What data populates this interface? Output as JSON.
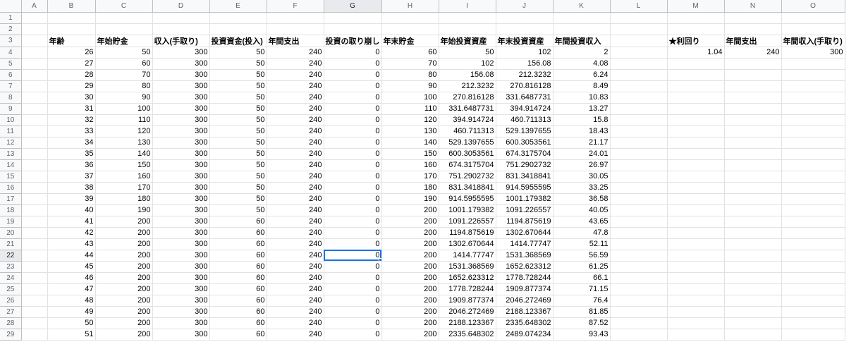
{
  "sheet": {
    "columns": [
      "",
      "A",
      "B",
      "C",
      "D",
      "E",
      "F",
      "G",
      "H",
      "I",
      "J",
      "K",
      "L",
      "M",
      "N",
      "O"
    ],
    "active_cell": {
      "row": 22,
      "col": "G"
    },
    "rows": [
      {
        "n": "1",
        "c": {}
      },
      {
        "n": "2",
        "c": {}
      },
      {
        "n": "3",
        "c": {
          "B": "年齢",
          "C": "年始貯金",
          "D": "収入(手取り)",
          "E": "投資資金(投入)",
          "F": "年間支出",
          "G": "投資の取り崩し",
          "H": "年末貯金",
          "I": "年始投資資産",
          "J": "年末投資資産",
          "K": "年間投資収入",
          "M": "★利回り",
          "N": "年間支出",
          "O": "年間収入(手取り)"
        }
      },
      {
        "n": "4",
        "c": {
          "B": "26",
          "C": "50",
          "D": "300",
          "E": "50",
          "F": "240",
          "G": "0",
          "H": "60",
          "I": "50",
          "J": "102",
          "K": "2",
          "M": "1.04",
          "N": "240",
          "O": "300"
        }
      },
      {
        "n": "5",
        "c": {
          "B": "27",
          "C": "60",
          "D": "300",
          "E": "50",
          "F": "240",
          "G": "0",
          "H": "70",
          "I": "102",
          "J": "156.08",
          "K": "4.08"
        }
      },
      {
        "n": "6",
        "c": {
          "B": "28",
          "C": "70",
          "D": "300",
          "E": "50",
          "F": "240",
          "G": "0",
          "H": "80",
          "I": "156.08",
          "J": "212.3232",
          "K": "6.24"
        }
      },
      {
        "n": "7",
        "c": {
          "B": "29",
          "C": "80",
          "D": "300",
          "E": "50",
          "F": "240",
          "G": "0",
          "H": "90",
          "I": "212.3232",
          "J": "270.816128",
          "K": "8.49"
        }
      },
      {
        "n": "8",
        "c": {
          "B": "30",
          "C": "90",
          "D": "300",
          "E": "50",
          "F": "240",
          "G": "0",
          "H": "100",
          "I": "270.816128",
          "J": "331.6487731",
          "K": "10.83"
        }
      },
      {
        "n": "9",
        "c": {
          "B": "31",
          "C": "100",
          "D": "300",
          "E": "50",
          "F": "240",
          "G": "0",
          "H": "110",
          "I": "331.6487731",
          "J": "394.914724",
          "K": "13.27"
        }
      },
      {
        "n": "10",
        "c": {
          "B": "32",
          "C": "110",
          "D": "300",
          "E": "50",
          "F": "240",
          "G": "0",
          "H": "120",
          "I": "394.914724",
          "J": "460.711313",
          "K": "15.8"
        }
      },
      {
        "n": "11",
        "c": {
          "B": "33",
          "C": "120",
          "D": "300",
          "E": "50",
          "F": "240",
          "G": "0",
          "H": "130",
          "I": "460.711313",
          "J": "529.1397655",
          "K": "18.43"
        }
      },
      {
        "n": "12",
        "c": {
          "B": "34",
          "C": "130",
          "D": "300",
          "E": "50",
          "F": "240",
          "G": "0",
          "H": "140",
          "I": "529.1397655",
          "J": "600.3053561",
          "K": "21.17"
        }
      },
      {
        "n": "13",
        "c": {
          "B": "35",
          "C": "140",
          "D": "300",
          "E": "50",
          "F": "240",
          "G": "0",
          "H": "150",
          "I": "600.3053561",
          "J": "674.3175704",
          "K": "24.01"
        }
      },
      {
        "n": "14",
        "c": {
          "B": "36",
          "C": "150",
          "D": "300",
          "E": "50",
          "F": "240",
          "G": "0",
          "H": "160",
          "I": "674.3175704",
          "J": "751.2902732",
          "K": "26.97"
        }
      },
      {
        "n": "15",
        "c": {
          "B": "37",
          "C": "160",
          "D": "300",
          "E": "50",
          "F": "240",
          "G": "0",
          "H": "170",
          "I": "751.2902732",
          "J": "831.3418841",
          "K": "30.05"
        }
      },
      {
        "n": "16",
        "c": {
          "B": "38",
          "C": "170",
          "D": "300",
          "E": "50",
          "F": "240",
          "G": "0",
          "H": "180",
          "I": "831.3418841",
          "J": "914.5955595",
          "K": "33.25"
        }
      },
      {
        "n": "17",
        "c": {
          "B": "39",
          "C": "180",
          "D": "300",
          "E": "50",
          "F": "240",
          "G": "0",
          "H": "190",
          "I": "914.5955595",
          "J": "1001.179382",
          "K": "36.58"
        }
      },
      {
        "n": "18",
        "c": {
          "B": "40",
          "C": "190",
          "D": "300",
          "E": "50",
          "F": "240",
          "G": "0",
          "H": "200",
          "I": "1001.179382",
          "J": "1091.226557",
          "K": "40.05"
        }
      },
      {
        "n": "19",
        "c": {
          "B": "41",
          "C": "200",
          "D": "300",
          "E": "60",
          "F": "240",
          "G": "0",
          "H": "200",
          "I": "1091.226557",
          "J": "1194.875619",
          "K": "43.65"
        }
      },
      {
        "n": "20",
        "c": {
          "B": "42",
          "C": "200",
          "D": "300",
          "E": "60",
          "F": "240",
          "G": "0",
          "H": "200",
          "I": "1194.875619",
          "J": "1302.670644",
          "K": "47.8"
        }
      },
      {
        "n": "21",
        "c": {
          "B": "43",
          "C": "200",
          "D": "300",
          "E": "60",
          "F": "240",
          "G": "0",
          "H": "200",
          "I": "1302.670644",
          "J": "1414.77747",
          "K": "52.11"
        }
      },
      {
        "n": "22",
        "c": {
          "B": "44",
          "C": "200",
          "D": "300",
          "E": "60",
          "F": "240",
          "G": "0",
          "H": "200",
          "I": "1414.77747",
          "J": "1531.368569",
          "K": "56.59"
        }
      },
      {
        "n": "23",
        "c": {
          "B": "45",
          "C": "200",
          "D": "300",
          "E": "60",
          "F": "240",
          "G": "0",
          "H": "200",
          "I": "1531.368569",
          "J": "1652.623312",
          "K": "61.25"
        }
      },
      {
        "n": "24",
        "c": {
          "B": "46",
          "C": "200",
          "D": "300",
          "E": "60",
          "F": "240",
          "G": "0",
          "H": "200",
          "I": "1652.623312",
          "J": "1778.728244",
          "K": "66.1"
        }
      },
      {
        "n": "25",
        "c": {
          "B": "47",
          "C": "200",
          "D": "300",
          "E": "60",
          "F": "240",
          "G": "0",
          "H": "200",
          "I": "1778.728244",
          "J": "1909.877374",
          "K": "71.15"
        }
      },
      {
        "n": "26",
        "c": {
          "B": "48",
          "C": "200",
          "D": "300",
          "E": "60",
          "F": "240",
          "G": "0",
          "H": "200",
          "I": "1909.877374",
          "J": "2046.272469",
          "K": "76.4"
        }
      },
      {
        "n": "27",
        "c": {
          "B": "49",
          "C": "200",
          "D": "300",
          "E": "60",
          "F": "240",
          "G": "0",
          "H": "200",
          "I": "2046.272469",
          "J": "2188.123367",
          "K": "81.85"
        }
      },
      {
        "n": "28",
        "c": {
          "B": "50",
          "C": "200",
          "D": "300",
          "E": "60",
          "F": "240",
          "G": "0",
          "H": "200",
          "I": "2188.123367",
          "J": "2335.648302",
          "K": "87.52"
        }
      },
      {
        "n": "29",
        "c": {
          "B": "51",
          "C": "200",
          "D": "300",
          "E": "60",
          "F": "240",
          "G": "0",
          "H": "200",
          "I": "2335.648302",
          "J": "2489.074234",
          "K": "93.43"
        }
      }
    ]
  }
}
